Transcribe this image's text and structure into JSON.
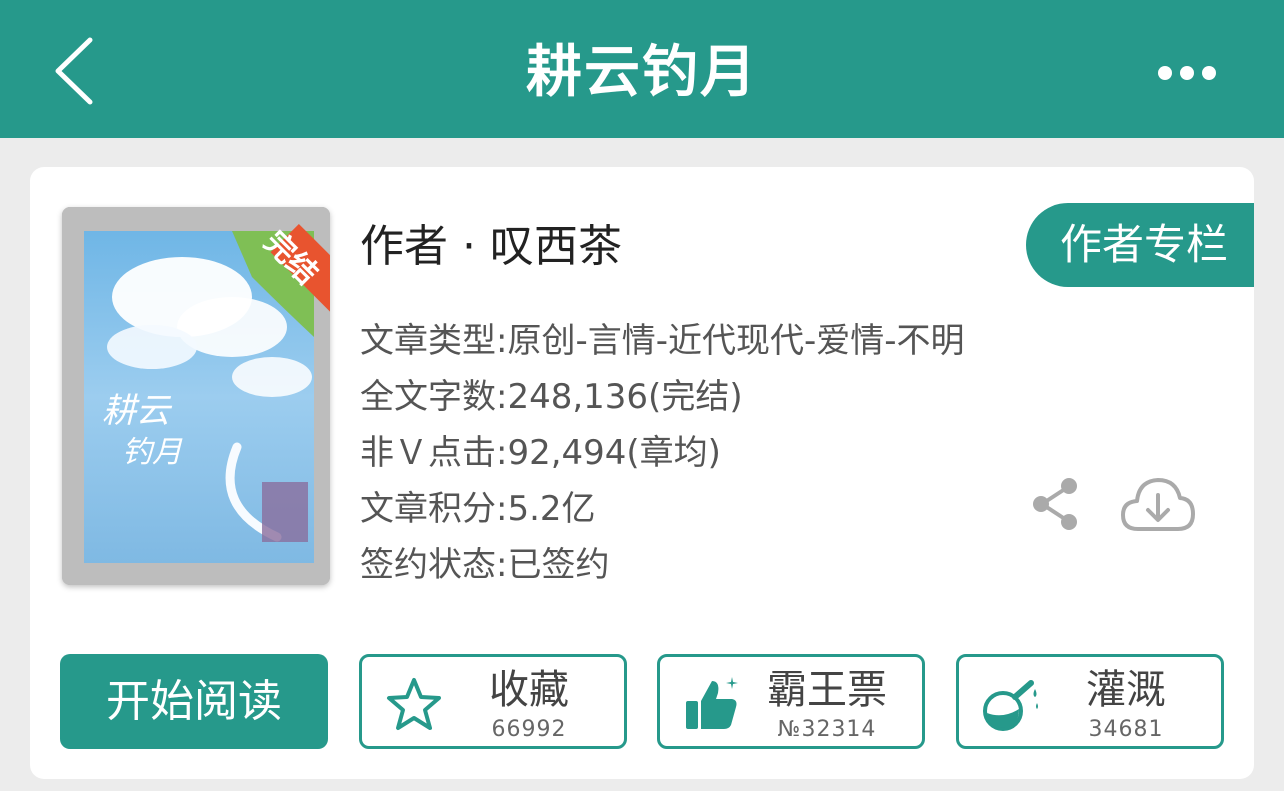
{
  "header": {
    "title": "耕云钓月",
    "back_icon": "chevron-left-icon",
    "more_icon": "more-horizontal-icon"
  },
  "book": {
    "cover_badge": "完结",
    "author_line": "作者 · 叹西茶",
    "author_column_label": "作者专栏",
    "meta": [
      "文章类型:原创-言情-近代现代-爱情-不明",
      "全文字数:248,136(完结)",
      "非Ｖ点击:92,494(章均)",
      "文章积分:5.2亿",
      "签约状态:已签约"
    ]
  },
  "actions": {
    "read_label": "开始阅读",
    "favorite": {
      "label": "收藏",
      "count": "66992",
      "icon": "star-icon"
    },
    "vote": {
      "label": "霸王票",
      "count": "№32314",
      "icon": "thumbs-up-icon"
    },
    "nutrient": {
      "label": "灌溉",
      "count": "34681",
      "icon": "flask-icon"
    }
  },
  "tools": {
    "share_icon": "share-icon",
    "download_icon": "cloud-download-icon"
  },
  "colors": {
    "primary": "#26998b",
    "background": "#ececec",
    "badge": "#e8542f"
  }
}
